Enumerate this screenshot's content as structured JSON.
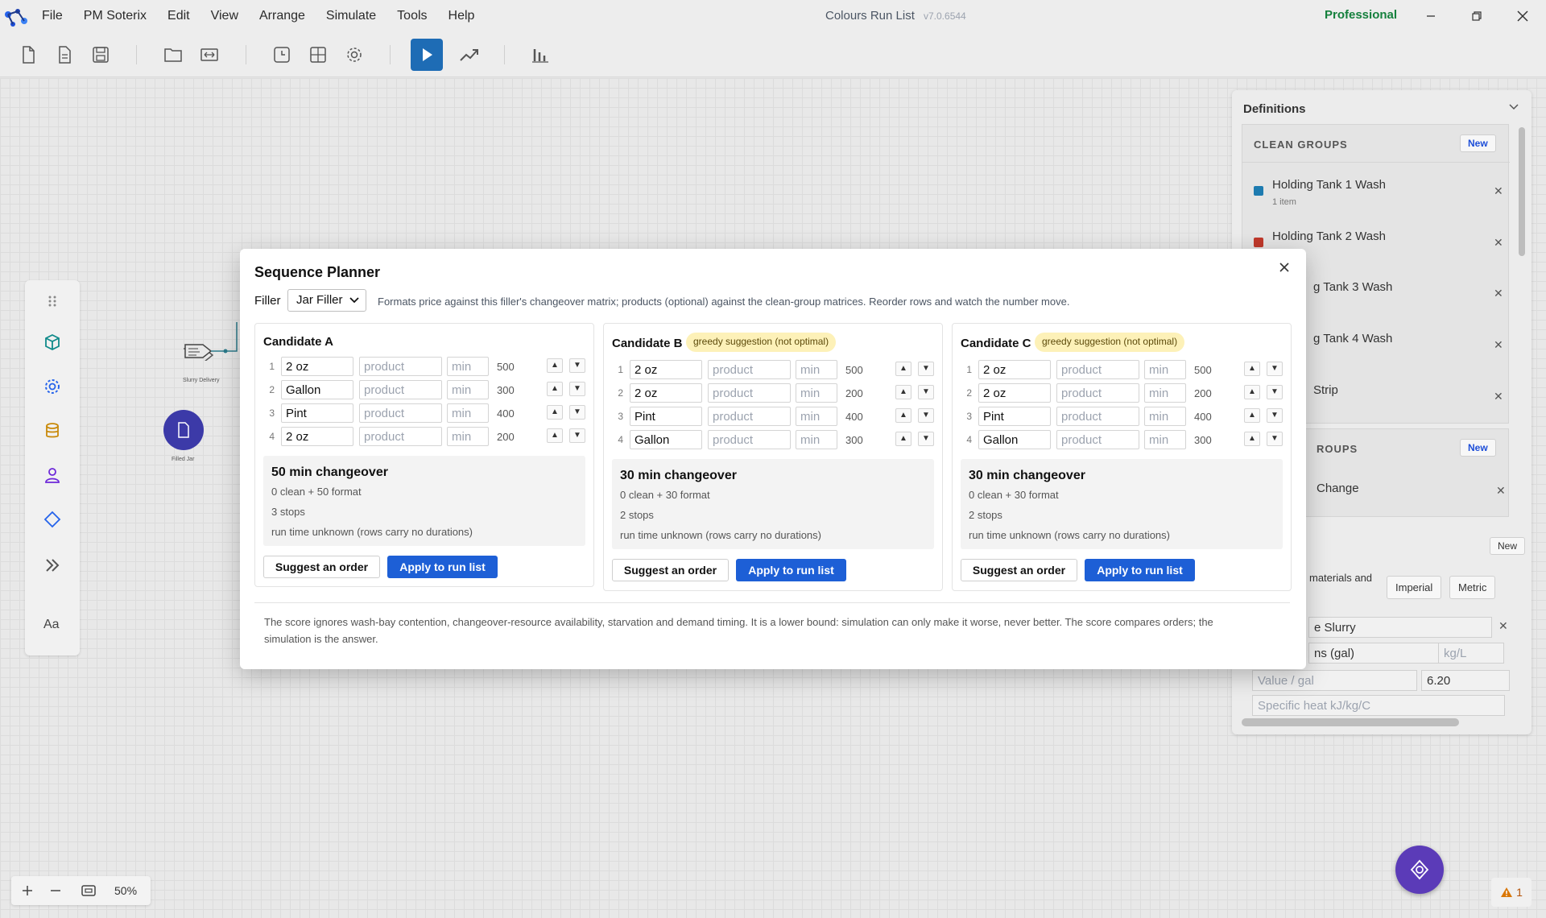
{
  "app": {
    "menu": [
      "File",
      "PM Soterix",
      "Edit",
      "View",
      "Arrange",
      "Simulate",
      "Tools",
      "Help"
    ],
    "window_title": "Colours Run List",
    "version": "v7.0.6544",
    "edition": "Professional"
  },
  "canvas": {
    "node1_label": "Slurry Delivery",
    "node2_label": "Filled Jar",
    "zoom_level": "50%",
    "warning_count": "1"
  },
  "definitions": {
    "title": "Definitions",
    "clean_groups_title": "CLEAN GROUPS",
    "new_label": "New",
    "clean_groups": [
      {
        "name": "Holding Tank 1 Wash",
        "sub": "1 item",
        "color": "#1d7bb0"
      },
      {
        "name": "Holding Tank 2 Wash",
        "sub": "",
        "color": "#c0392b"
      },
      {
        "name": "g Tank 3 Wash",
        "sub": "",
        "color": ""
      },
      {
        "name": "g Tank 4 Wash",
        "sub": "",
        "color": ""
      },
      {
        "name": "Strip",
        "sub": "",
        "color": ""
      }
    ],
    "format_groups_title": "ROUPS",
    "format_items": [
      "Change"
    ],
    "materials_text": "materials and",
    "imperial": "Imperial",
    "metric": "Metric",
    "material_name": "e Slurry",
    "unit": "ns (gal)",
    "density_placeholder": "kg/L",
    "value_label": "Value / gal",
    "value": "6.20",
    "specific_heat_label": "Specific heat kJ/kg/C"
  },
  "planner": {
    "title": "Sequence Planner",
    "filler_label": "Filler",
    "filler_value": "Jar Filler",
    "description": "Formats price against this filler's changeover matrix; products (optional) against the clean-group matrices. Reorder rows and watch the number move.",
    "product_placeholder": "product",
    "min_placeholder": "min",
    "up_arrow": "▲",
    "down_arrow": "▼",
    "suggest_label": "Suggest an order",
    "apply_label": "Apply to run list",
    "candidates": [
      {
        "title": "Candidate A",
        "badge": "",
        "rows": [
          {
            "n": "1",
            "format": "2 oz",
            "qty": "500"
          },
          {
            "n": "2",
            "format": "Gallon",
            "qty": "300"
          },
          {
            "n": "3",
            "format": "Pint",
            "qty": "400"
          },
          {
            "n": "4",
            "format": "2 oz",
            "qty": "200"
          }
        ],
        "changeover": "50 min changeover",
        "breakdown": "0 clean + 50 format",
        "stops": "3 stops",
        "run_time": "run time unknown (rows carry no durations)"
      },
      {
        "title": "Candidate B",
        "badge": "greedy suggestion (not optimal)",
        "rows": [
          {
            "n": "1",
            "format": "2 oz",
            "qty": "500"
          },
          {
            "n": "2",
            "format": "2 oz",
            "qty": "200"
          },
          {
            "n": "3",
            "format": "Pint",
            "qty": "400"
          },
          {
            "n": "4",
            "format": "Gallon",
            "qty": "300"
          }
        ],
        "changeover": "30 min changeover",
        "breakdown": "0 clean + 30 format",
        "stops": "2 stops",
        "run_time": "run time unknown (rows carry no durations)"
      },
      {
        "title": "Candidate C",
        "badge": "greedy suggestion (not optimal)",
        "rows": [
          {
            "n": "1",
            "format": "2 oz",
            "qty": "500"
          },
          {
            "n": "2",
            "format": "2 oz",
            "qty": "200"
          },
          {
            "n": "3",
            "format": "Pint",
            "qty": "400"
          },
          {
            "n": "4",
            "format": "Gallon",
            "qty": "300"
          }
        ],
        "changeover": "30 min changeover",
        "breakdown": "0 clean + 30 format",
        "stops": "2 stops",
        "run_time": "run time unknown (rows carry no durations)"
      }
    ],
    "footer": "The score ignores wash-bay contention, changeover-resource availability, starvation and demand timing. It is a lower bound: simulation can only make it worse, never better. The score compares orders; the simulation is the answer."
  },
  "colors": {
    "accent": "#1d5fd6",
    "badge_bg": "#fdf1b8",
    "fab": "#5b3bb8",
    "edition": "#15803d"
  }
}
